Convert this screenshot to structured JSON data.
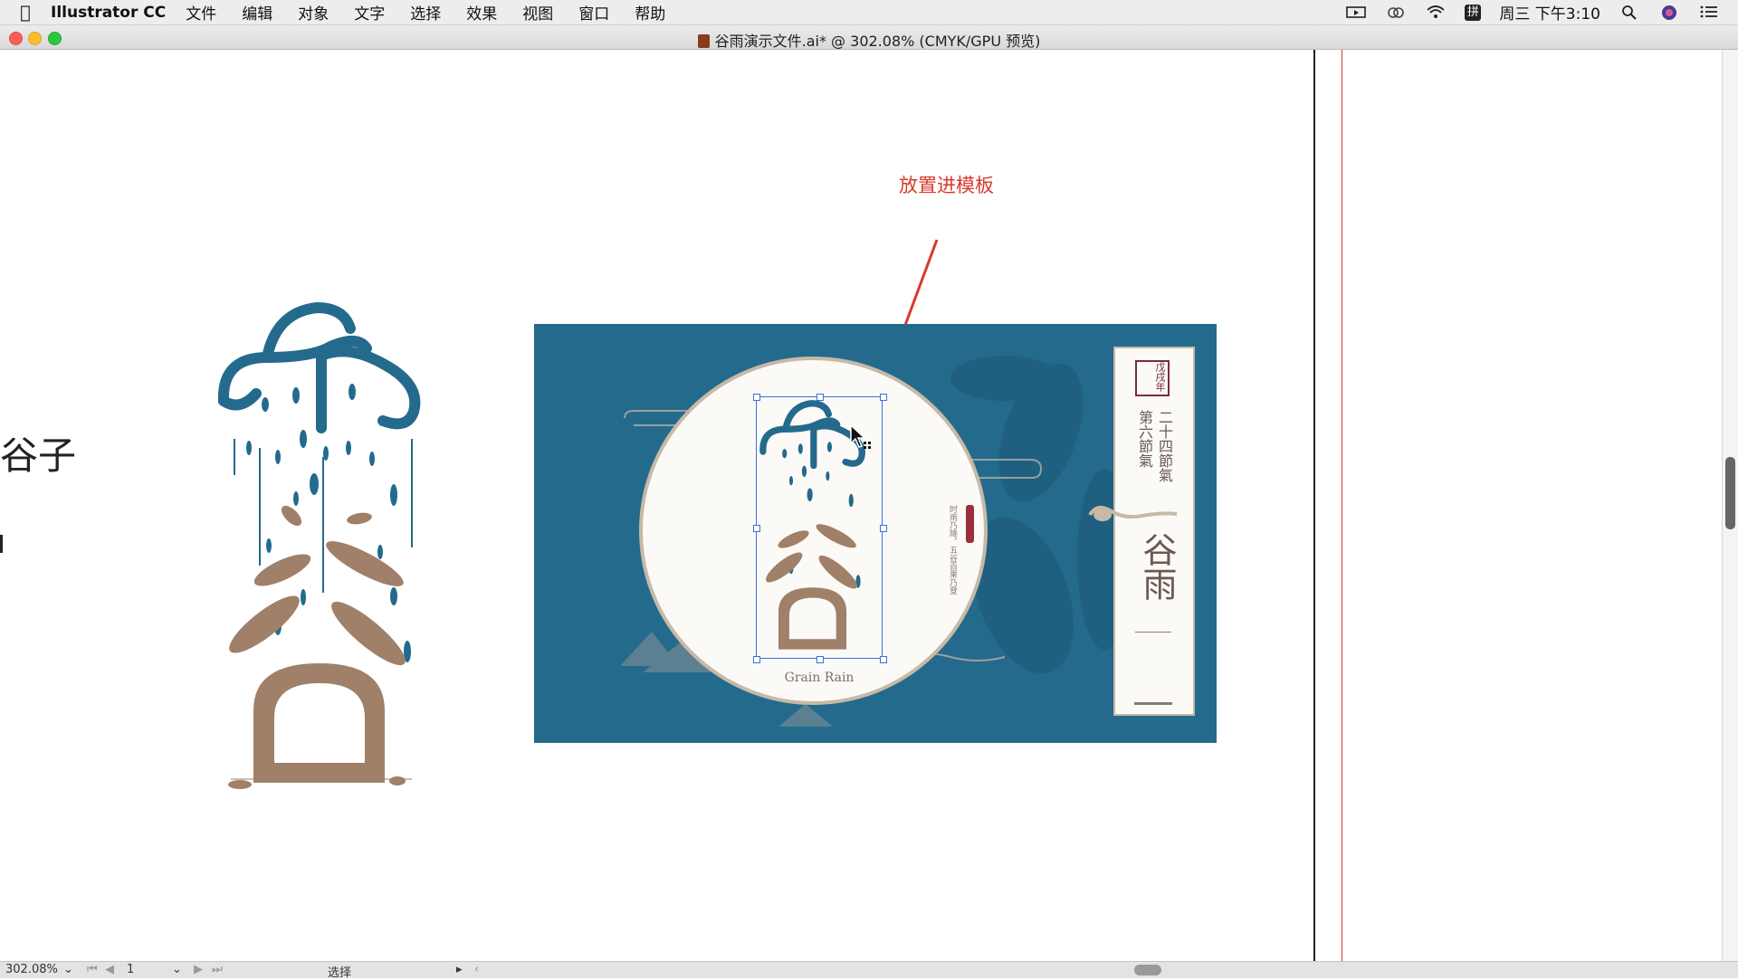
{
  "menubar": {
    "app_name": "Illustrator CC",
    "items": [
      "文件",
      "编辑",
      "对象",
      "文字",
      "选择",
      "效果",
      "视图",
      "窗口",
      "帮助"
    ],
    "clock": "周三 下午3:10",
    "input_method": "拼"
  },
  "window": {
    "title": "谷雨演示文件.ai* @ 302.08% (CMYK/GPU 预览)"
  },
  "canvas": {
    "annotation": "放置进模板",
    "left_text": "谷子",
    "badge_caption": "Grain Rain",
    "poem": "时雨乃降，五谷百果乃登",
    "panel": {
      "year": "戊戌年",
      "main_title": "谷雨",
      "solar_term_a": "二十四節氣",
      "solar_term_b": "第六節氣"
    }
  },
  "statusbar": {
    "zoom": "302.08%",
    "artboard_number": "1",
    "tool": "选择"
  },
  "colors": {
    "board_blue": "#246a8c",
    "logo_blue": "#246a8c",
    "leaf_brown": "#a08068",
    "annotation_red": "#d83a2c",
    "guide_red": "#d8343a"
  }
}
